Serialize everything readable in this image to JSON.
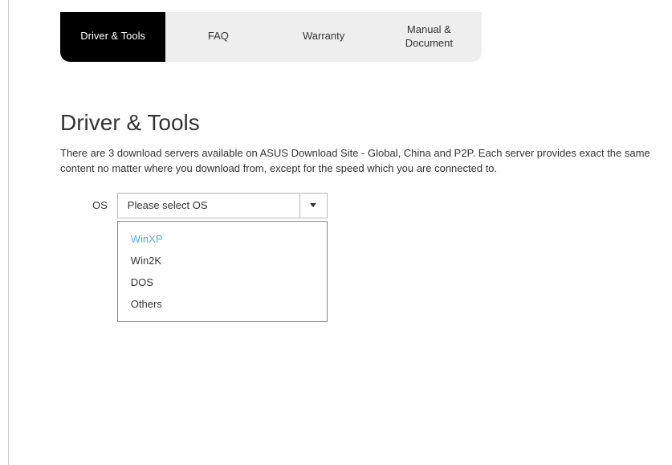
{
  "tabs": {
    "items": [
      {
        "label": "Driver & Tools",
        "active": true
      },
      {
        "label": "FAQ",
        "active": false
      },
      {
        "label": "Warranty",
        "active": false
      },
      {
        "label": "Manual & Document",
        "active": false
      }
    ]
  },
  "page": {
    "title": "Driver & Tools",
    "description": "There are 3 download servers available on ASUS Download Site - Global, China and P2P. Each server provides exact the same content no matter where you download from, except for the speed which you are connected to."
  },
  "os_selector": {
    "label": "OS",
    "placeholder": "Please select OS",
    "options": [
      {
        "label": "WinXP",
        "highlighted": true
      },
      {
        "label": "Win2K",
        "highlighted": false
      },
      {
        "label": "DOS",
        "highlighted": false
      },
      {
        "label": "Others",
        "highlighted": false
      }
    ]
  }
}
